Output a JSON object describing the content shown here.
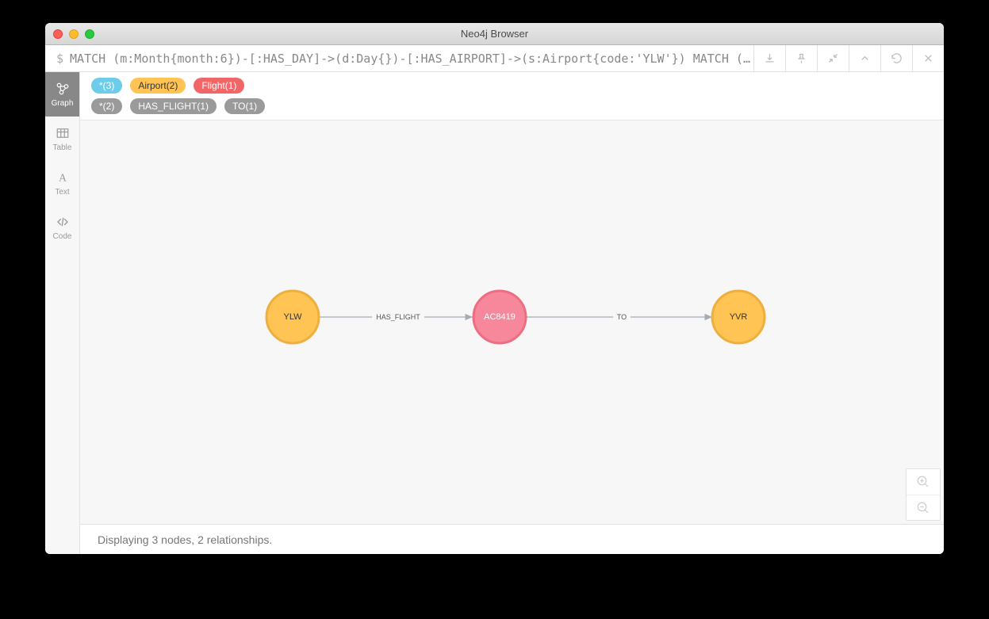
{
  "window": {
    "title": "Neo4j Browser"
  },
  "query": {
    "prompt": "$",
    "text": "MATCH (m:Month{month:6})-[:HAS_DAY]->(d:Day{})-[:HAS_AIRPORT]->(s:Airport{code:'YLW'}) MATCH (t:Airport{code…"
  },
  "sidebar": {
    "tabs": [
      {
        "label": "Graph"
      },
      {
        "label": "Table"
      },
      {
        "label": "Text"
      },
      {
        "label": "Code"
      }
    ]
  },
  "nodePills": [
    {
      "name": "*",
      "count": "(3)"
    },
    {
      "name": "Airport",
      "count": "(2)"
    },
    {
      "name": "Flight",
      "count": "(1)"
    }
  ],
  "relPills": [
    {
      "name": "*",
      "count": "(2)"
    },
    {
      "name": "HAS_FLIGHT",
      "count": "(1)"
    },
    {
      "name": "TO",
      "count": "(1)"
    }
  ],
  "graph": {
    "nodes": [
      {
        "id": "n1",
        "label": "YLW"
      },
      {
        "id": "n2",
        "label": "AC8419"
      },
      {
        "id": "n3",
        "label": "YVR"
      }
    ],
    "edges": [
      {
        "label": "HAS_FLIGHT"
      },
      {
        "label": "TO"
      }
    ]
  },
  "footer": {
    "status": "Displaying 3 nodes, 2 relationships."
  }
}
